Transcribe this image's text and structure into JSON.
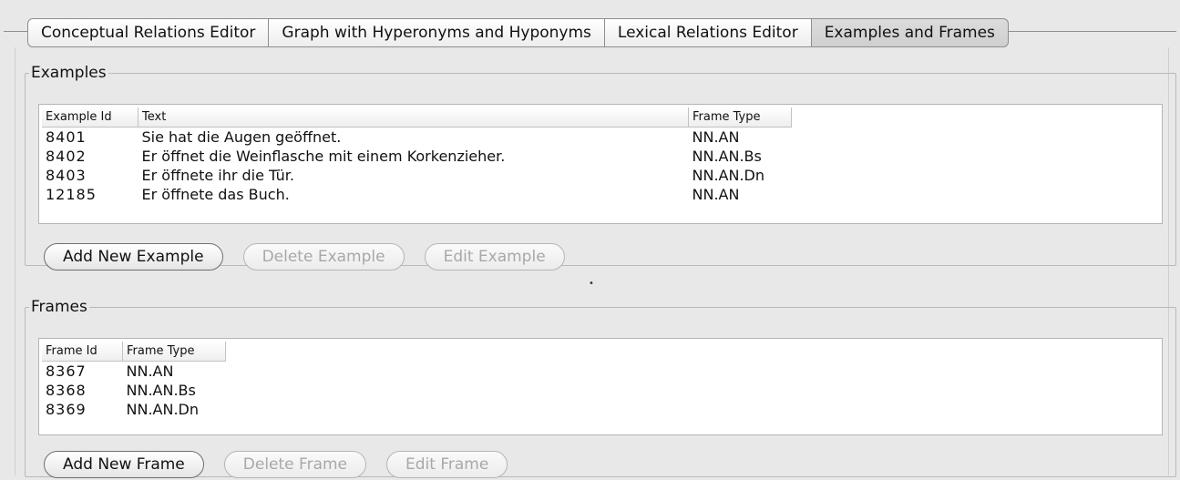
{
  "tabs": [
    {
      "label": "Conceptual Relations Editor",
      "selected": false
    },
    {
      "label": "Graph with Hyperonyms and Hyponyms",
      "selected": false
    },
    {
      "label": "Lexical Relations Editor",
      "selected": false
    },
    {
      "label": "Examples and Frames",
      "selected": true
    }
  ],
  "examples": {
    "title": "Examples",
    "columns": [
      "Example Id",
      "Text",
      "Frame Type"
    ],
    "rows": [
      {
        "id": "8401",
        "text": "Sie hat die Augen geöffnet.",
        "frame_type": "NN.AN"
      },
      {
        "id": "8402",
        "text": "Er öffnet die Weinflasche mit einem Korkenzieher.",
        "frame_type": "NN.AN.Bs"
      },
      {
        "id": "8403",
        "text": "Er öffnete ihr die Tür.",
        "frame_type": "NN.AN.Dn"
      },
      {
        "id": "12185",
        "text": "Er öffnete das Buch.",
        "frame_type": "NN.AN"
      }
    ],
    "buttons": {
      "add": "Add New Example",
      "delete": "Delete Example",
      "edit": "Edit Example"
    }
  },
  "frames": {
    "title": "Frames",
    "columns": [
      "Frame Id",
      "Frame Type"
    ],
    "rows": [
      {
        "id": "8367",
        "frame_type": "NN.AN"
      },
      {
        "id": "8368",
        "frame_type": "NN.AN.Bs"
      },
      {
        "id": "8369",
        "frame_type": "NN.AN.Dn"
      }
    ],
    "buttons": {
      "add": "Add New Frame",
      "delete": "Delete Frame",
      "edit": "Edit Frame"
    }
  },
  "splitter": {
    "glyph": "•"
  }
}
